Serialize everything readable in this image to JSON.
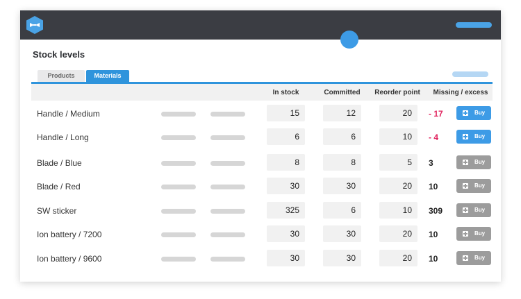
{
  "page": {
    "title": "Stock levels"
  },
  "tabs": [
    {
      "label": "Products"
    },
    {
      "label": "Materials"
    }
  ],
  "columns": {
    "in_stock": "In stock",
    "committed": "Committed",
    "reorder": "Reorder point",
    "missing": "Missing / excess"
  },
  "colors": {
    "accent": "#2f94dc",
    "negative": "#e0245e",
    "topbar": "#3b3d43",
    "buy_inactive": "#9c9c9c"
  },
  "rows": [
    {
      "name": "Handle / Medium",
      "in_stock": "15",
      "committed": "12",
      "reorder": "20",
      "missing": "- 17",
      "negative": true,
      "buy_label": "Buy",
      "buy_active": true
    },
    {
      "name": "Handle / Long",
      "in_stock": "6",
      "committed": "6",
      "reorder": "10",
      "missing": "- 4",
      "negative": true,
      "buy_label": "Buy",
      "buy_active": true
    },
    {
      "name": "Blade / Blue",
      "in_stock": "8",
      "committed": "8",
      "reorder": "5",
      "missing": "3",
      "negative": false,
      "buy_label": "Buy",
      "buy_active": false
    },
    {
      "name": "Blade / Red",
      "in_stock": "30",
      "committed": "30",
      "reorder": "20",
      "missing": "10",
      "negative": false,
      "buy_label": "Buy",
      "buy_active": false
    },
    {
      "name": "SW sticker",
      "in_stock": "325",
      "committed": "6",
      "reorder": "10",
      "missing": "309",
      "negative": false,
      "buy_label": "Buy",
      "buy_active": false
    },
    {
      "name": "Ion battery / 7200",
      "in_stock": "30",
      "committed": "30",
      "reorder": "20",
      "missing": "10",
      "negative": false,
      "buy_label": "Buy",
      "buy_active": false
    },
    {
      "name": "Ion battery / 9600",
      "in_stock": "30",
      "committed": "30",
      "reorder": "20",
      "missing": "10",
      "negative": false,
      "buy_label": "Buy",
      "buy_active": false
    }
  ]
}
